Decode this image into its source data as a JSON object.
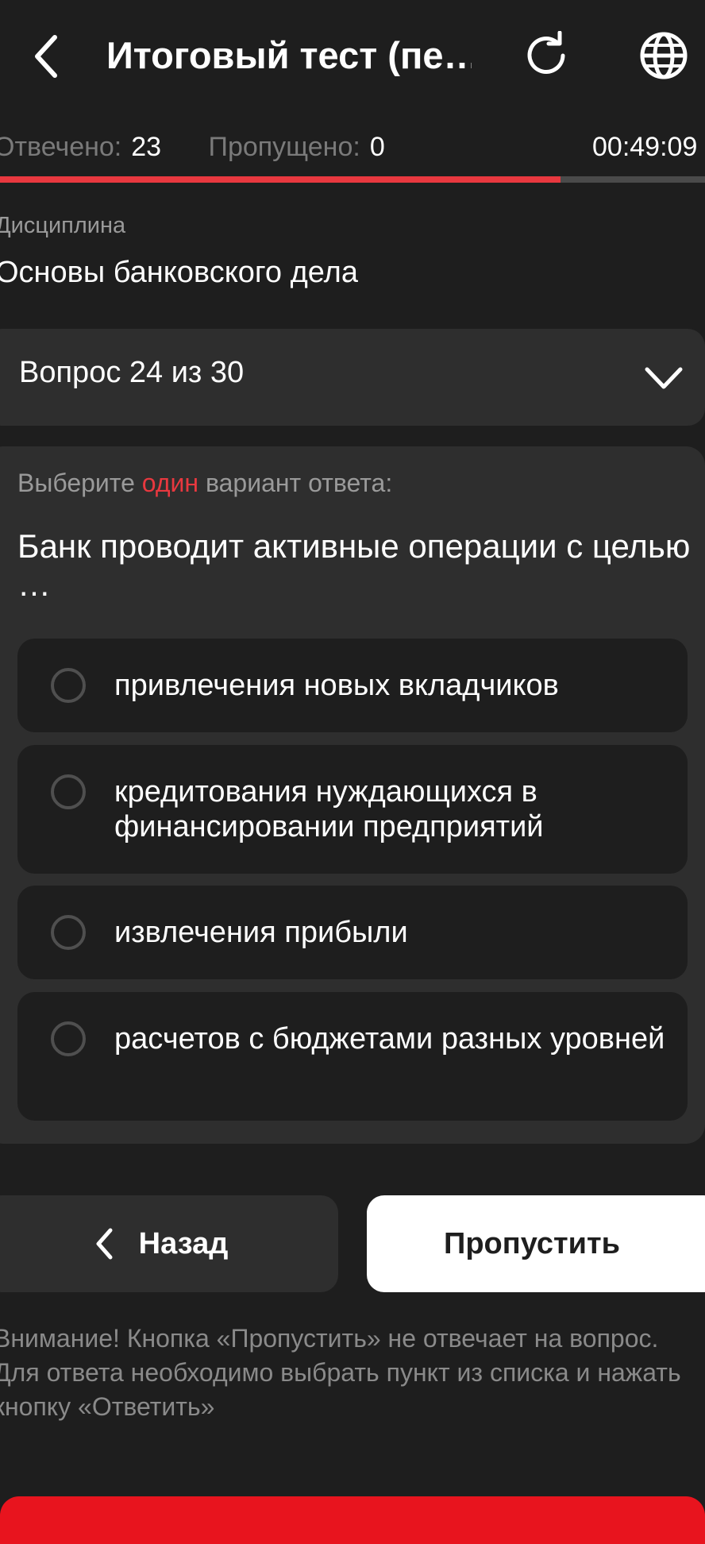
{
  "header": {
    "title": "Итоговый тест (пе…",
    "back_icon": "chevron-left-icon",
    "reload_icon": "reload-icon",
    "globe_icon": "globe-icon"
  },
  "stats": {
    "answered_label": "Отвечено:",
    "answered_value": "23",
    "skipped_label": "Пропущено:",
    "skipped_value": "0",
    "timer": "00:49:09"
  },
  "progress": {
    "fraction": 0.795,
    "fill_color": "#e8383f"
  },
  "discipline": {
    "label": "Дисциплина",
    "value": "Основы банковского дела"
  },
  "question_selector": {
    "label": "Вопрос 24 из 30",
    "icon": "chevron-down-icon"
  },
  "question": {
    "instruction_before": "Выберите",
    "instruction_accent": "один",
    "instruction_after": "вариант ответа:",
    "text": "Банк проводит активные операции с целью …",
    "options": [
      {
        "label": "привлечения новых вкладчиков",
        "selected": false
      },
      {
        "label": "кредитования нуждающихся в финансировании предприятий",
        "selected": false
      },
      {
        "label": "извлечения прибыли",
        "selected": false
      },
      {
        "label": "расчетов с бюджетами разных уровней",
        "selected": false
      }
    ]
  },
  "buttons": {
    "back_label": "Назад",
    "skip_label": "Пропустить"
  },
  "notice": "Внимание! Кнопка «Пропустить» не отвечает на вопрос. Для ответа необходимо выбрать пункт из списка и нажать кнопку «Ответить»",
  "colors": {
    "background": "#1e1e1e",
    "card": "#2e2e2e",
    "accent": "#e8383f",
    "bottom_bar": "#e8141e"
  }
}
